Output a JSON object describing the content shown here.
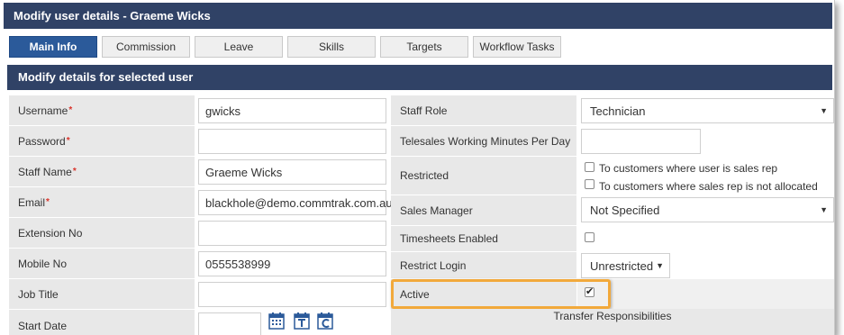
{
  "window": {
    "title": "Modify user details - Graeme Wicks"
  },
  "tabs": [
    {
      "label": "Main Info",
      "active": true
    },
    {
      "label": "Commission",
      "active": false
    },
    {
      "label": "Leave",
      "active": false
    },
    {
      "label": "Skills",
      "active": false
    },
    {
      "label": "Targets",
      "active": false
    },
    {
      "label": "Workflow Tasks",
      "active": false
    }
  ],
  "section": {
    "title": "Modify details for selected user"
  },
  "left_fields": [
    {
      "label": "Username",
      "required": "*",
      "value": "gwicks"
    },
    {
      "label": "Password",
      "required": "*",
      "value": ""
    },
    {
      "label": "Staff Name",
      "required": "*",
      "value": "Graeme Wicks"
    },
    {
      "label": "Email",
      "required": "*",
      "value": "blackhole@demo.commtrak.com.au"
    },
    {
      "label": "Extension No",
      "required": "",
      "value": ""
    },
    {
      "label": "Mobile No",
      "required": "",
      "value": "0555538999"
    },
    {
      "label": "Job Title",
      "required": "",
      "value": ""
    },
    {
      "label": "Start Date",
      "required": "",
      "value": ""
    }
  ],
  "right_fields": {
    "staff_role": {
      "label": "Staff Role",
      "value": "Technician"
    },
    "telesales": {
      "label": "Telesales Working Minutes Per Day",
      "value": ""
    },
    "restricted": {
      "label": "Restricted",
      "opt1": "To customers where user is sales rep",
      "opt2": "To customers where sales rep is not allocated"
    },
    "sales_manager": {
      "label": "Sales Manager",
      "value": "Not Specified"
    },
    "timesheets": {
      "label": "Timesheets Enabled"
    },
    "restrict_login": {
      "label": "Restrict Login",
      "value": "Unrestricted"
    },
    "active": {
      "label": "Active",
      "checked": true
    },
    "transfer": {
      "label": "Transfer Responsibilities"
    }
  },
  "icons": [
    "calendar-icon",
    "calendar-today-icon",
    "calendar-clear-icon"
  ],
  "colors": {
    "header": "#304266",
    "active_tab": "#2b5a9a",
    "highlight": "#f2a93b",
    "required": "#d9342b"
  }
}
